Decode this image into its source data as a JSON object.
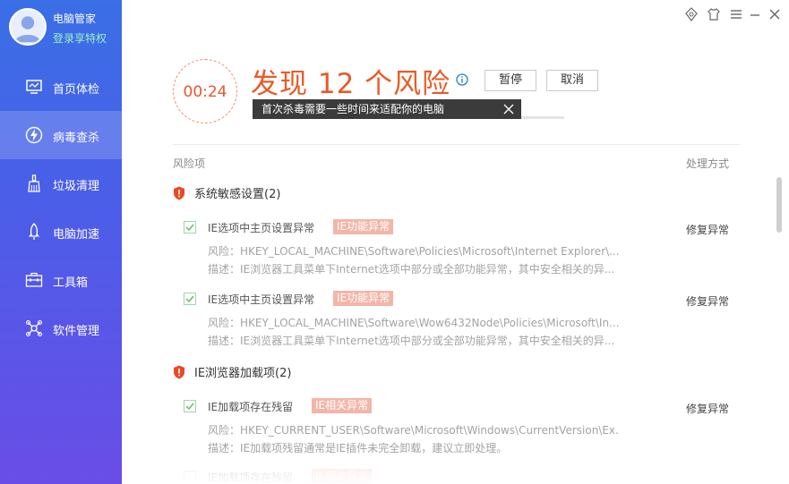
{
  "sidebar": {
    "app_name": "电脑管家",
    "vip_link": "登录享特权",
    "items": [
      {
        "label": "首页体检",
        "icon": "monitor-icon"
      },
      {
        "label": "病毒查杀",
        "icon": "lightning-icon"
      },
      {
        "label": "垃圾清理",
        "icon": "broom-icon"
      },
      {
        "label": "电脑加速",
        "icon": "rocket-icon"
      },
      {
        "label": "工具箱",
        "icon": "toolbox-icon"
      },
      {
        "label": "软件管理",
        "icon": "apps-icon"
      }
    ],
    "active_index": 1
  },
  "window_controls": [
    "skin-icon",
    "shirt-icon",
    "menu-icon",
    "minimize-icon",
    "close-icon"
  ],
  "scan": {
    "timer": "00:24",
    "title": "发现 12 个风险",
    "pause_label": "暂停",
    "cancel_label": "取消",
    "tooltip": "首次杀毒需要一些时间来适配你的电脑",
    "progress": 0.79
  },
  "columns": {
    "risk": "风险项",
    "action": "处理方式"
  },
  "groups": [
    {
      "title": "系统敏感设置(2)",
      "items": [
        {
          "title": "IE选项中主页设置异常",
          "tag": "IE功能异常",
          "action": "修复异常",
          "risk": "风险：HKEY_LOCAL_MACHINE\\Software\\Policies\\Microsoft\\Internet Explorer\\...",
          "desc": "描述：IE浏览器工具菜单下Internet选项中部分或全部功能异常，其中安全相关的异..."
        },
        {
          "title": "IE选项中主页设置异常",
          "tag": "IE功能异常",
          "action": "修复异常",
          "risk": "风险：HKEY_LOCAL_MACHINE\\Software\\Wow6432Node\\Policies\\Microsoft\\In...",
          "desc": "描述：IE浏览器工具菜单下Internet选项中部分或全部功能异常，其中安全相关的异..."
        }
      ]
    },
    {
      "title": "IE浏览器加载项(2)",
      "items": [
        {
          "title": "IE加载项存在残留",
          "tag": "IE相关异常",
          "action": "修复异常",
          "risk": "风险：HKEY_CURRENT_USER\\Software\\Microsoft\\Windows\\CurrentVersion\\Ex...",
          "desc": "描述：IE加载项残留通常是IE插件未完全卸载，建议立即处理。"
        }
      ]
    }
  ],
  "colors": {
    "accent": "#ea5a25",
    "sidebar_top": "#3a6fe6",
    "sidebar_bottom": "#6a4de6",
    "progress": "#e0322a",
    "tag_bg": "#f2b6a8"
  }
}
